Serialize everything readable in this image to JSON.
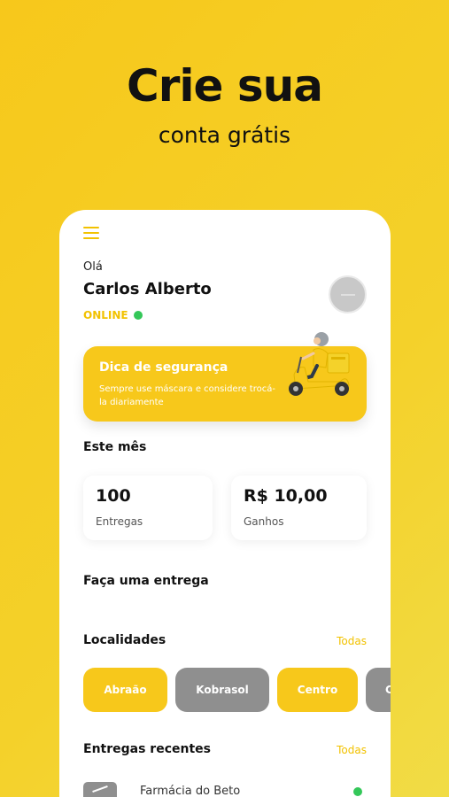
{
  "promo": {
    "headline": "Crie sua",
    "subheadline": "conta grátis"
  },
  "app": {
    "menu_icon": "hamburger-menu-icon",
    "greeting": "Olá",
    "user_name": "Carlos Alberto",
    "status": "ONLINE",
    "status_color": "#34c759",
    "accent_color": "#f7c81b",
    "tip": {
      "title": "Dica de segurança",
      "text": "Sempre use máscara e considere trocá-la diariamente"
    },
    "month": {
      "title": "Este mês",
      "deliveries_value": "100",
      "deliveries_label": "Entregas",
      "earnings_value": "R$ 10,00",
      "earnings_label": "Ganhos"
    },
    "make_delivery": "Faça uma entrega",
    "locations": {
      "title": "Localidades",
      "see_all": "Todas",
      "items": [
        "Abraão",
        "Kobrasol",
        "Centro",
        "C"
      ]
    },
    "recent": {
      "title": "Entregas recentes",
      "see_all": "Todas",
      "items": [
        {
          "name": "Farmácia do Beto"
        }
      ]
    }
  }
}
